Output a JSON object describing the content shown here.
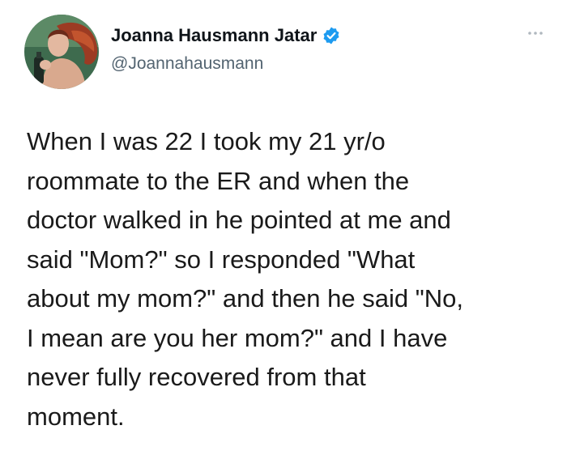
{
  "tweet": {
    "author": {
      "display_name": "Joanna Hausmann Jatar",
      "handle": "@Joannahausmann",
      "verified": true,
      "avatar_icon": "profile-photo-icon"
    },
    "more_icon": "more-options-icon",
    "text": "When I was 22 I took my 21 yr/o\nroommate to the ER and when the\ndoctor walked in he pointed at me and\nsaid \"Mom?\" so I responded \"What\nabout my mom?\" and then he said \"No,\nI mean are you her mom?\" and I have\nnever fully recovered from that\nmoment.",
    "colors": {
      "verified_badge": "#1d9bf0",
      "handle": "#536471",
      "text": "#0f1419"
    }
  }
}
